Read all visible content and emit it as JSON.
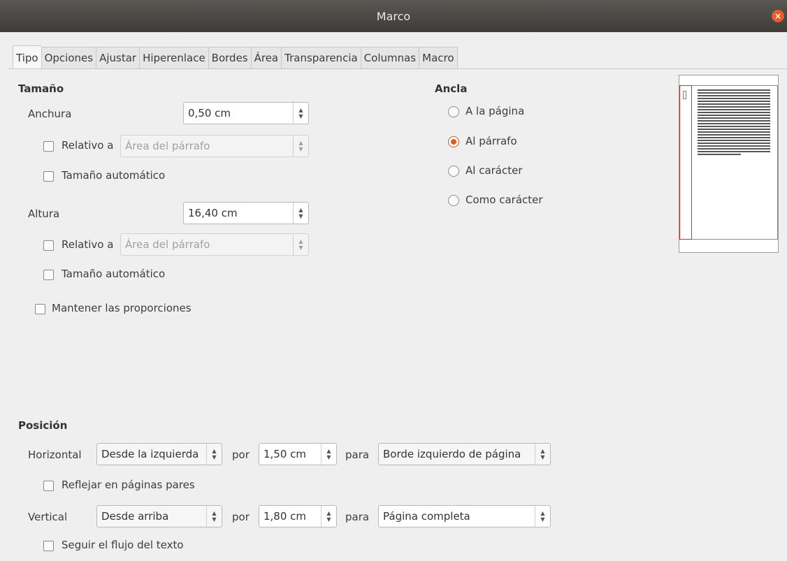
{
  "window": {
    "title": "Marco",
    "close": "×"
  },
  "tabs": [
    "Tipo",
    "Opciones",
    "Ajustar",
    "Hiperenlace",
    "Bordes",
    "Área",
    "Transparencia",
    "Columnas",
    "Macro"
  ],
  "size": {
    "heading": "Tamaño",
    "width_label": "Anchura",
    "width_value": "0,50 cm",
    "width_relative_label": "Relativo a",
    "width_relative_value": "Área del párrafo",
    "width_auto_label": "Tamaño automático",
    "height_label": "Altura",
    "height_value": "16,40 cm",
    "height_relative_label": "Relativo a",
    "height_relative_value": "Área del párrafo",
    "height_auto_label": "Tamaño automático",
    "keep_ratio_label": "Mantener las proporciones"
  },
  "anchor": {
    "heading": "Ancla",
    "options": [
      "A la página",
      "Al párrafo",
      "Al carácter",
      "Como carácter"
    ],
    "selected": "Al párrafo"
  },
  "position": {
    "heading": "Posición",
    "horizontal_label": "Horizontal",
    "horizontal_value": "Desde la izquierda",
    "h_by_label": "por",
    "h_by_value": "1,50 cm",
    "h_to_label": "para",
    "h_to_value": "Borde izquierdo de página",
    "mirror_label": "Reflejar en páginas pares",
    "vertical_label": "Vertical",
    "vertical_value": "Desde arriba",
    "v_by_label": "por",
    "v_by_value": "1,80 cm",
    "v_to_label": "para",
    "v_to_value": "Página completa",
    "follow_label": "Seguir el flujo del texto"
  },
  "icons": {
    "spin": "spin-arrows-icon",
    "close": "close-icon"
  },
  "colors": {
    "accent": "#e05a22",
    "titlebar": "#4a4945",
    "preview_frame": "#d0302e",
    "preview_anchor": "#3bb54a"
  }
}
